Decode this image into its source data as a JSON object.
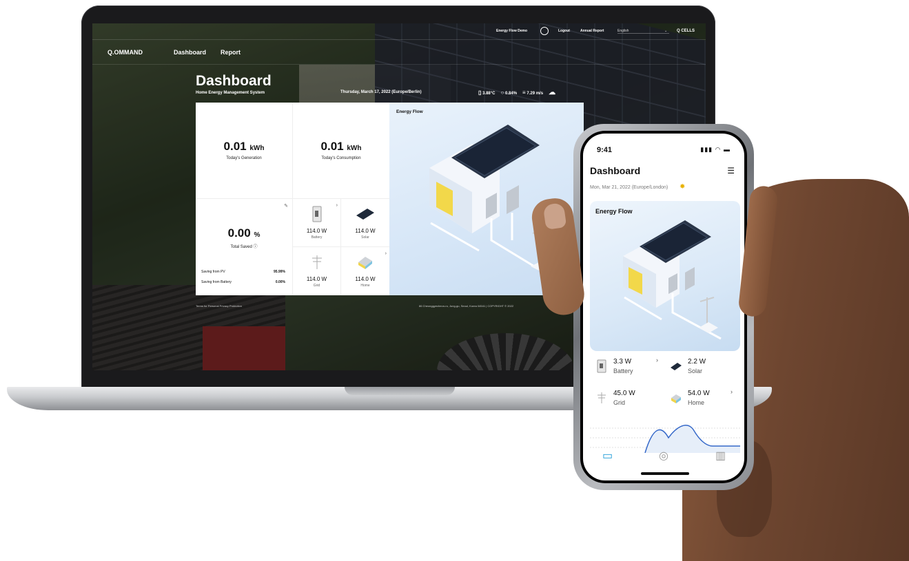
{
  "laptop": {
    "topbar": {
      "demo": "Energy Flow Demo",
      "logout": "Logout",
      "annual_report": "Annual Report",
      "language": "English",
      "logo": "Q CELLS"
    },
    "nav": {
      "brand": "Q.OMMAND",
      "dashboard": "Dashboard",
      "report": "Report"
    },
    "title": "Dashboard",
    "subtitle": "Home Energy Management System",
    "date": "Thursday, March 17, 2022 (Europe/Berlin)",
    "weather": {
      "temperature": "3.88°C",
      "humidity": "0.84%",
      "wind": "7.29 m/s"
    },
    "generation": {
      "value": "0.01",
      "unit": "kWh",
      "label": "Today's Generation"
    },
    "consumption": {
      "value": "0.01",
      "unit": "kWh",
      "label": "Today's Consumption"
    },
    "saved": {
      "value": "0.00",
      "unit": "%",
      "label": "Total Saved",
      "pv_label": "Saving from PV",
      "pv_value": "95.99%",
      "battery_label": "Saving from Battery",
      "battery_value": "0.00%"
    },
    "devices": {
      "battery": {
        "value": "114.0 W",
        "label": "Battery"
      },
      "solar": {
        "value": "114.0 W",
        "label": "Solar"
      },
      "grid": {
        "value": "114.0 W",
        "label": "Grid"
      },
      "home": {
        "value": "114.0 W",
        "label": "Home"
      }
    },
    "energy_flow_title": "Energy Flow",
    "footer_left": "Terms for Personal Privacy Protection",
    "footer_right": "86 Cheonggyecheon-ro, Jung-gu, Seoul, Korea 04541  |  COPYRIGHT © 2022"
  },
  "phone": {
    "time": "9:41",
    "title": "Dashboard",
    "date": "Mon, Mar 21, 2022 (Europe/London)",
    "energy_flow_title": "Energy Flow",
    "devices": {
      "battery": {
        "value": "3.3 W",
        "label": "Battery"
      },
      "solar": {
        "value": "2.2 W",
        "label": "Solar"
      },
      "grid": {
        "value": "45.0 W",
        "label": "Grid"
      },
      "home": {
        "value": "54.0 W",
        "label": "Home"
      }
    }
  },
  "colors": {
    "accent_blue": "#1e9bd7",
    "flow_bg": "#d6e6f7",
    "window_yellow": "#f2d84a"
  }
}
